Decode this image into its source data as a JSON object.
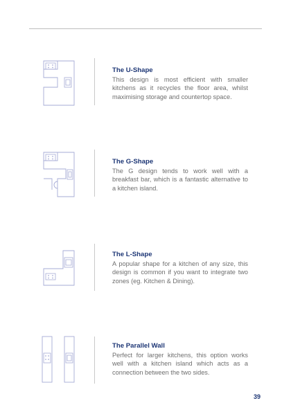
{
  "sections": [
    {
      "title": "The U-Shape",
      "description": "This design is most efficient with smaller kitchens as it recycles the floor area, whilst maximising storage and countertop space.",
      "icon": "u-shape-kitchen-icon"
    },
    {
      "title": "The G-Shape",
      "description": "The G design tends to work well with a breakfast bar, which is a fantastic alternative to a kitchen island.",
      "icon": "g-shape-kitchen-icon"
    },
    {
      "title": "The L-Shape",
      "description": "A popular shape for a kitchen of any size, this design is common if you want to integrate two zones (eg. Kitchen & Dining).",
      "icon": "l-shape-kitchen-icon"
    },
    {
      "title": "The Parallel Wall",
      "description": "Perfect for larger kitchens, this option works well with a kitchen island which acts as a connection between the two sides.",
      "icon": "parallel-wall-kitchen-icon"
    }
  ],
  "page_number": "39",
  "colors": {
    "title": "#1d3675",
    "body_text": "#6e6e6e",
    "diagram_line": "#a6abd6",
    "rule": "#bdbdbd"
  }
}
